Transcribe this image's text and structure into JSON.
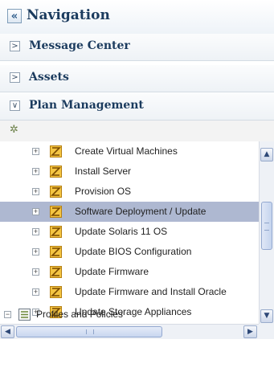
{
  "header": {
    "title": "Navigation",
    "collapse_icon": "double-chevron-left-icon"
  },
  "sections": [
    {
      "label": "Message Center",
      "expanded": false
    },
    {
      "label": "Assets",
      "expanded": false
    },
    {
      "label": "Plan Management",
      "expanded": true
    }
  ],
  "toolbar": {
    "refresh_icon": "refresh-icon"
  },
  "tree": {
    "items": [
      {
        "label": "Create Virtual Machines",
        "selected": false
      },
      {
        "label": "Install Server",
        "selected": false
      },
      {
        "label": "Provision OS",
        "selected": false
      },
      {
        "label": "Software Deployment / Update",
        "selected": true
      },
      {
        "label": "Update Solaris 11 OS",
        "selected": false
      },
      {
        "label": "Update BIOS Configuration",
        "selected": false
      },
      {
        "label": "Update Firmware",
        "selected": false
      },
      {
        "label": "Update Firmware and Install Oracle",
        "selected": false
      },
      {
        "label": "Update Storage Appliances",
        "selected": false
      }
    ],
    "parent_item": {
      "label": "Profiles and Policies"
    }
  },
  "colors": {
    "selected_row": "#aeb8d1",
    "heading_text": "#1b3b5e"
  }
}
